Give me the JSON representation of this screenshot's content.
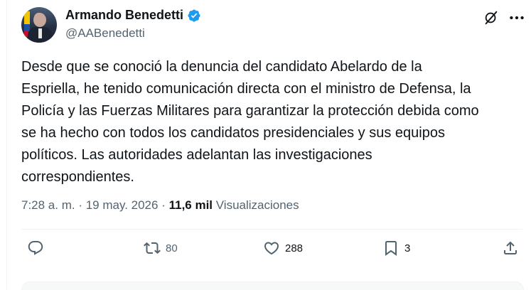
{
  "author": {
    "name": "Armando Benedetti",
    "handle": "@AABenedetti",
    "verified": true
  },
  "tweet": {
    "text": "Desde que se conoció la denuncia del candidato Abelardo de la\nEspriella, he tenido comunicación directa con el ministro de Defensa, la\nPolicía y las Fuerzas Militares para garantizar la protección debida como\nse ha hecho con todos los candidatos presidenciales y sus equipos\npolíticos. Las autoridades adelantan las investigaciones\ncorrespondientes."
  },
  "meta": {
    "time": "7:28 a. m.",
    "separator": " · ",
    "date": "19 may. 2026",
    "separator2": " · ",
    "views_count": "11,6 mil",
    "views_label": " Visualizaciones"
  },
  "actions": {
    "reply_count": "",
    "repost_count": "80",
    "like_count": "288",
    "bookmark_count": "3"
  },
  "icons": {
    "verified": "verified-badge-icon",
    "grok": "grok-icon",
    "more": "more-icon",
    "reply": "reply-icon",
    "repost": "repost-icon",
    "like": "heart-icon",
    "bookmark": "bookmark-icon",
    "share": "share-icon"
  },
  "colors": {
    "verified": "#1d9bf0",
    "text": "#0f1419",
    "secondary": "#536471",
    "border": "#eff3f4"
  }
}
